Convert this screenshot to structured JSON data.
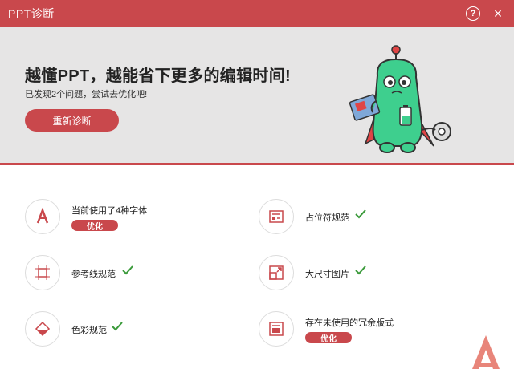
{
  "window": {
    "title": "PPT诊断",
    "help_icon": "?",
    "close_icon": "×"
  },
  "hero": {
    "headline": "越懂PPT，越能省下更多的编辑时间!",
    "subline": "已发现2个问题，尝试去优化吧!",
    "rediagnose_label": "重新诊断",
    "mascot": "green-robot-mascot"
  },
  "items": [
    {
      "label": "当前使用了4种字体",
      "icon": "font-a-icon",
      "status": "issue",
      "action_label": "优化"
    },
    {
      "label": "占位符规范",
      "icon": "placeholder-icon",
      "status": "ok"
    },
    {
      "label": "参考线规范",
      "icon": "guide-lines-icon",
      "status": "ok"
    },
    {
      "label": "大尺寸图片",
      "icon": "large-image-icon",
      "status": "ok"
    },
    {
      "label": "色彩规范",
      "icon": "color-fill-icon",
      "status": "ok"
    },
    {
      "label": "存在未使用的冗余版式",
      "icon": "layout-icon",
      "status": "issue",
      "action_label": "优化"
    }
  ],
  "colors": {
    "accent": "#c9484c",
    "check": "#3a9a3a",
    "hero_bg": "#e6e5e5"
  }
}
